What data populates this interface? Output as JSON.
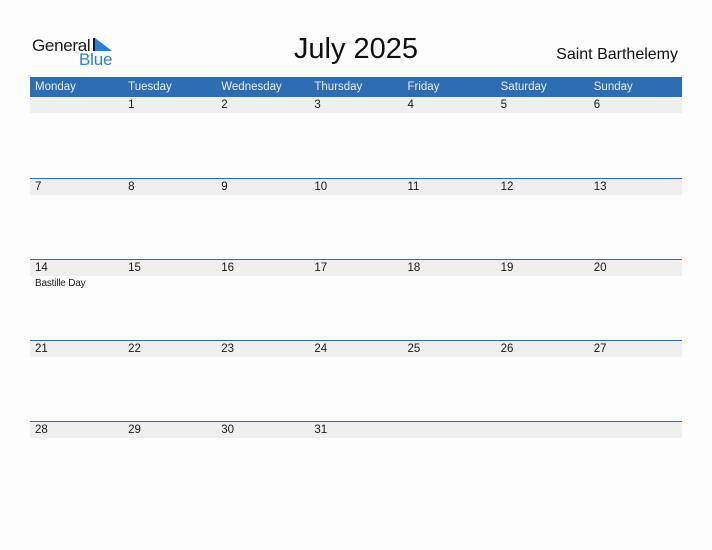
{
  "logo": {
    "general": "General",
    "blue": "Blue"
  },
  "title": "July 2025",
  "country": "Saint Barthelemy",
  "colors": {
    "header_bg": "#2e6db1",
    "date_strip_bg": "#efefef",
    "logo_blue": "#2a7fd0"
  },
  "weekdays": [
    "Monday",
    "Tuesday",
    "Wednesday",
    "Thursday",
    "Friday",
    "Saturday",
    "Sunday"
  ],
  "weeks": [
    {
      "days": [
        "",
        "1",
        "2",
        "3",
        "4",
        "5",
        "6"
      ],
      "events": [
        "",
        "",
        "",
        "",
        "",
        "",
        ""
      ]
    },
    {
      "days": [
        "7",
        "8",
        "9",
        "10",
        "11",
        "12",
        "13"
      ],
      "events": [
        "",
        "",
        "",
        "",
        "",
        "",
        ""
      ]
    },
    {
      "days": [
        "14",
        "15",
        "16",
        "17",
        "18",
        "19",
        "20"
      ],
      "events": [
        "Bastille Day",
        "",
        "",
        "",
        "",
        "",
        ""
      ]
    },
    {
      "days": [
        "21",
        "22",
        "23",
        "24",
        "25",
        "26",
        "27"
      ],
      "events": [
        "",
        "",
        "",
        "",
        "",
        "",
        ""
      ]
    },
    {
      "days": [
        "28",
        "29",
        "30",
        "31",
        "",
        "",
        ""
      ],
      "events": [
        "",
        "",
        "",
        "",
        "",
        "",
        ""
      ]
    }
  ]
}
